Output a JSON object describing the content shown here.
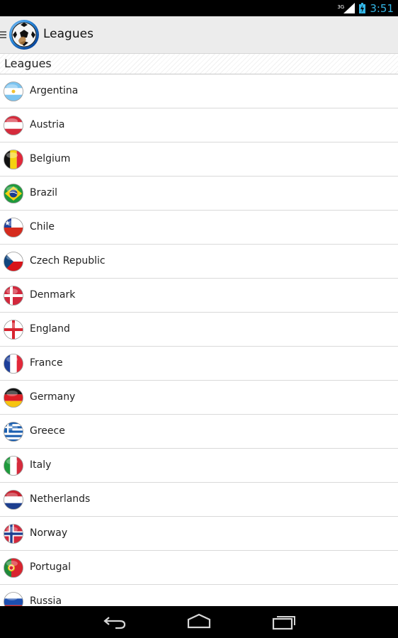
{
  "status": {
    "network": "3G",
    "time": "3:51"
  },
  "app": {
    "title": "Leagues"
  },
  "section": {
    "title": "Leagues"
  },
  "countries": [
    "Argentina",
    "Austria",
    "Belgium",
    "Brazil",
    "Chile",
    "Czech Republic",
    "Denmark",
    "England",
    "France",
    "Germany",
    "Greece",
    "Italy",
    "Netherlands",
    "Norway",
    "Portugal",
    "Russia"
  ],
  "icons": {
    "flags": [
      "argentina-flag-icon",
      "austria-flag-icon",
      "belgium-flag-icon",
      "brazil-flag-icon",
      "chile-flag-icon",
      "czech-republic-flag-icon",
      "denmark-flag-icon",
      "england-flag-icon",
      "france-flag-icon",
      "germany-flag-icon",
      "greece-flag-icon",
      "italy-flag-icon",
      "netherlands-flag-icon",
      "norway-flag-icon",
      "portugal-flag-icon",
      "russia-flag-icon"
    ],
    "nav": [
      "back-icon",
      "home-icon",
      "recent-apps-icon"
    ]
  },
  "colors": {
    "accent": "#33b5e5",
    "actionbar": "#ececec"
  }
}
